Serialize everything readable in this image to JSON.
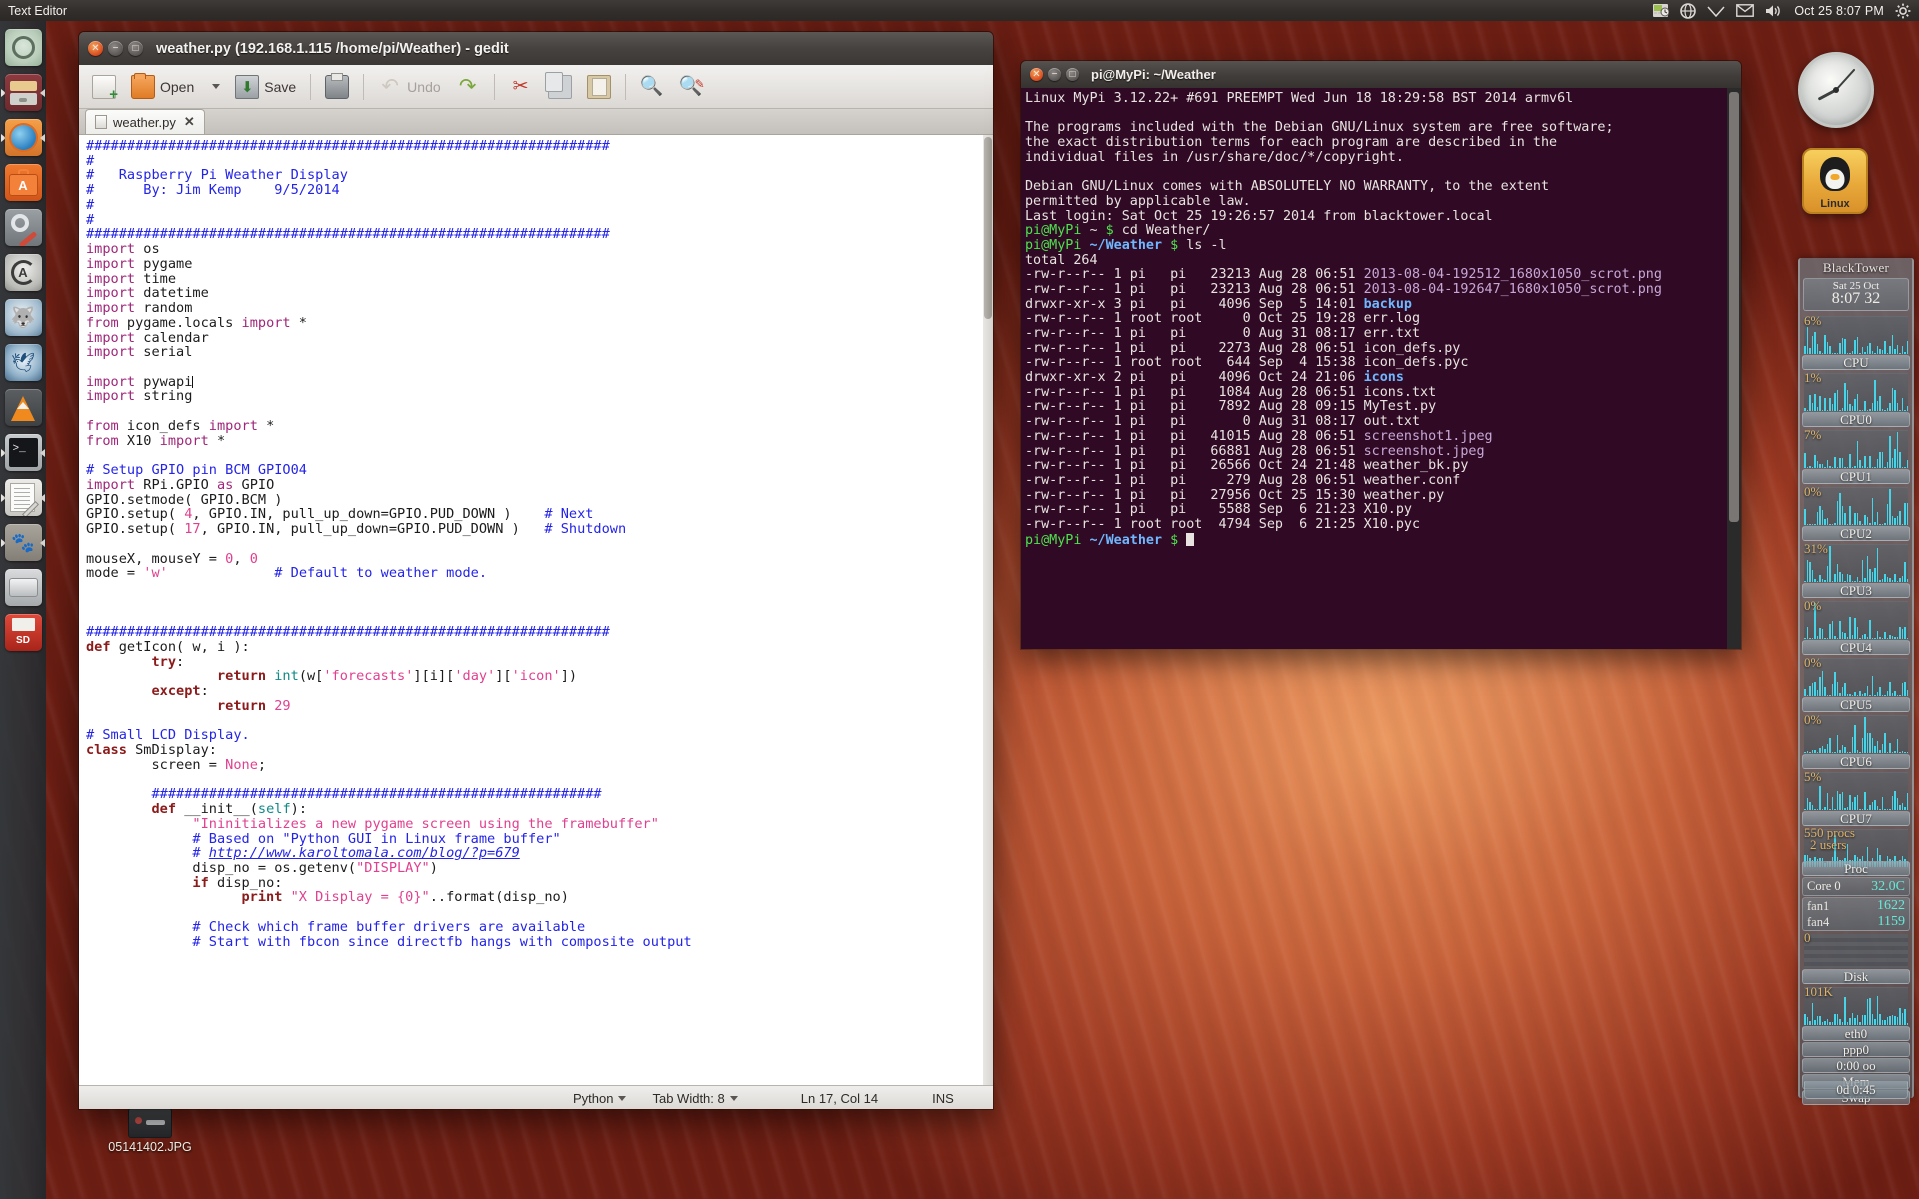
{
  "top_panel": {
    "title": "Text Editor",
    "indicators": [
      "workspace-switcher-icon",
      "network-icon",
      "wifi-icon",
      "mail-icon",
      "volume-icon"
    ],
    "clock": "Oct 25  8:07 PM",
    "session_icon": "gear-icon"
  },
  "launcher": {
    "items": [
      {
        "name": "ubuntu-dash",
        "label": "Ubuntu Dash",
        "running": false
      },
      {
        "name": "files",
        "label": "Files",
        "running": true
      },
      {
        "name": "firefox",
        "label": "Firefox",
        "running": true
      },
      {
        "name": "software-center",
        "label": "Ubuntu Software Center",
        "running": false
      },
      {
        "name": "system-settings",
        "label": "System Settings",
        "running": false
      },
      {
        "name": "software-updater",
        "label": "Software Updater",
        "running": false
      },
      {
        "name": "wolf-app",
        "label": "Amarok",
        "running": false
      },
      {
        "name": "thunderbird",
        "label": "Thunderbird",
        "running": false
      },
      {
        "name": "vlc",
        "label": "VLC Media Player",
        "running": false
      },
      {
        "name": "terminal",
        "label": "Terminal",
        "running": true
      },
      {
        "name": "gedit",
        "label": "Text Editor",
        "running": true
      },
      {
        "name": "gimp",
        "label": "GIMP",
        "running": true
      },
      {
        "name": "disk",
        "label": "Disk",
        "running": false
      },
      {
        "name": "sd-card",
        "label": "SD Card",
        "running": false
      }
    ]
  },
  "desktop": {
    "icon_label": "05141402.JPG"
  },
  "gedit": {
    "title": "weather.py (192.168.1.115 /home/pi/Weather) - gedit",
    "window_buttons": {
      "close": "close-button",
      "minimize": "minimize-button",
      "maximize": "maximize-button"
    },
    "toolbar": {
      "new_label": "",
      "open_label": "Open",
      "save_label": "Save",
      "print_label": "",
      "undo_label": "Undo",
      "redo_label": "",
      "cut_label": "",
      "copy_label": "",
      "paste_label": "",
      "find_label": "",
      "replace_label": ""
    },
    "tab": {
      "label": "weather.py",
      "close": "✕"
    },
    "status": {
      "language": "Python",
      "tab_width": "Tab Width: 8",
      "position": "Ln 17, Col 14",
      "insert_mode": "INS"
    },
    "code_lines": [
      [
        [
          "cmt",
          "################################################################"
        ]
      ],
      [
        [
          "cmt",
          "#"
        ]
      ],
      [
        [
          "cmt",
          "#   Raspberry Pi Weather Display"
        ]
      ],
      [
        [
          "cmt",
          "#      By: Jim Kemp    9/5/2014"
        ]
      ],
      [
        [
          "cmt",
          "#"
        ]
      ],
      [
        [
          "cmt",
          "#"
        ]
      ],
      [
        [
          "cmt",
          "################################################################"
        ]
      ],
      [
        [
          "kw",
          "import"
        ],
        [
          "plain",
          " os"
        ]
      ],
      [
        [
          "kw",
          "import"
        ],
        [
          "plain",
          " pygame"
        ]
      ],
      [
        [
          "kw",
          "import"
        ],
        [
          "plain",
          " time"
        ]
      ],
      [
        [
          "kw",
          "import"
        ],
        [
          "plain",
          " datetime"
        ]
      ],
      [
        [
          "kw",
          "import"
        ],
        [
          "plain",
          " random"
        ]
      ],
      [
        [
          "kw",
          "from"
        ],
        [
          "plain",
          " pygame.locals "
        ],
        [
          "kw",
          "import"
        ],
        [
          "plain",
          " *"
        ]
      ],
      [
        [
          "kw",
          "import"
        ],
        [
          "plain",
          " calendar"
        ]
      ],
      [
        [
          "kw",
          "import"
        ],
        [
          "plain",
          " serial"
        ]
      ],
      [
        [
          "plain",
          ""
        ]
      ],
      [
        [
          "kw",
          "import"
        ],
        [
          "plain",
          " pywapi"
        ],
        [
          "cursor",
          ""
        ]
      ],
      [
        [
          "kw",
          "import"
        ],
        [
          "plain",
          " string"
        ]
      ],
      [
        [
          "plain",
          ""
        ]
      ],
      [
        [
          "kw",
          "from"
        ],
        [
          "plain",
          " icon_defs "
        ],
        [
          "kw",
          "import"
        ],
        [
          "plain",
          " *"
        ]
      ],
      [
        [
          "kw",
          "from"
        ],
        [
          "plain",
          " X10 "
        ],
        [
          "kw",
          "import"
        ],
        [
          "plain",
          " *"
        ]
      ],
      [
        [
          "plain",
          ""
        ]
      ],
      [
        [
          "cmt",
          "# Setup GPIO pin BCM GPIO04"
        ]
      ],
      [
        [
          "kw",
          "import"
        ],
        [
          "plain",
          " RPi.GPIO "
        ],
        [
          "kw",
          "as"
        ],
        [
          "plain",
          " GPIO"
        ]
      ],
      [
        [
          "plain",
          "GPIO.setmode( GPIO.BCM )"
        ]
      ],
      [
        [
          "plain",
          "GPIO.setup( "
        ],
        [
          "num",
          "4"
        ],
        [
          "plain",
          ", GPIO.IN, pull_up_down=GPIO.PUD_DOWN )    "
        ],
        [
          "cmt",
          "# Next"
        ]
      ],
      [
        [
          "plain",
          "GPIO.setup( "
        ],
        [
          "num",
          "17"
        ],
        [
          "plain",
          ", GPIO.IN, pull_up_down=GPIO.PUD_DOWN )   "
        ],
        [
          "cmt",
          "# Shutdown"
        ]
      ],
      [
        [
          "plain",
          ""
        ]
      ],
      [
        [
          "plain",
          "mouseX, mouseY = "
        ],
        [
          "num",
          "0"
        ],
        [
          "plain",
          ", "
        ],
        [
          "num",
          "0"
        ]
      ],
      [
        [
          "plain",
          "mode = "
        ],
        [
          "str",
          "'w'"
        ],
        [
          "plain",
          "             "
        ],
        [
          "cmt",
          "# Default to weather mode."
        ]
      ],
      [
        [
          "plain",
          ""
        ]
      ],
      [
        [
          "plain",
          ""
        ]
      ],
      [
        [
          "plain",
          ""
        ]
      ],
      [
        [
          "cmt",
          "################################################################"
        ]
      ],
      [
        [
          "kw2",
          "def"
        ],
        [
          "plain",
          " getIcon( w, i ):"
        ]
      ],
      [
        [
          "plain",
          "        "
        ],
        [
          "kw2",
          "try"
        ],
        [
          "plain",
          ":"
        ]
      ],
      [
        [
          "plain",
          "                "
        ],
        [
          "kw2",
          "return"
        ],
        [
          "plain",
          " "
        ],
        [
          "bi",
          "int"
        ],
        [
          "plain",
          "(w["
        ],
        [
          "str",
          "'forecasts'"
        ],
        [
          "plain",
          "][i]["
        ],
        [
          "str",
          "'day'"
        ],
        [
          "plain",
          "]["
        ],
        [
          "str",
          "'icon'"
        ],
        [
          "plain",
          "])"
        ]
      ],
      [
        [
          "plain",
          "        "
        ],
        [
          "kw2",
          "except"
        ],
        [
          "plain",
          ":"
        ]
      ],
      [
        [
          "plain",
          "                "
        ],
        [
          "kw2",
          "return"
        ],
        [
          "plain",
          " "
        ],
        [
          "num",
          "29"
        ]
      ],
      [
        [
          "plain",
          ""
        ]
      ],
      [
        [
          "cmt",
          "# Small LCD Display."
        ]
      ],
      [
        [
          "kw2",
          "class"
        ],
        [
          "plain",
          " SmDisplay:"
        ]
      ],
      [
        [
          "plain",
          "        screen = "
        ],
        [
          "num",
          "None"
        ],
        [
          "plain",
          ";"
        ]
      ],
      [
        [
          "plain",
          ""
        ]
      ],
      [
        [
          "plain",
          "        "
        ],
        [
          "cmt",
          "#######################################################"
        ]
      ],
      [
        [
          "plain",
          "        "
        ],
        [
          "kw2",
          "def"
        ],
        [
          "plain",
          " __init__("
        ],
        [
          "cls",
          "self"
        ],
        [
          "plain",
          "):"
        ]
      ],
      [
        [
          "plain",
          "             "
        ],
        [
          "str",
          "\"Ininitializes a new pygame screen using the framebuffer\""
        ]
      ],
      [
        [
          "plain",
          "             "
        ],
        [
          "cmt",
          "# Based on \"Python GUI in Linux frame buffer\""
        ]
      ],
      [
        [
          "plain",
          "             "
        ],
        [
          "cmt",
          "# "
        ],
        [
          "cmt-u",
          "http://www.karoltomala.com/blog/?p=679"
        ]
      ],
      [
        [
          "plain",
          "             disp_no = os.getenv("
        ],
        [
          "str",
          "\"DISPLAY\""
        ],
        [
          "plain",
          ")"
        ]
      ],
      [
        [
          "plain",
          "             "
        ],
        [
          "kw2",
          "if"
        ],
        [
          "plain",
          " disp_no:"
        ]
      ],
      [
        [
          "plain",
          "                   "
        ],
        [
          "kw2",
          "print"
        ],
        [
          "plain",
          " "
        ],
        [
          "str",
          "\"X Display = {0}\""
        ],
        [
          "plain",
          "..format(disp_no)"
        ]
      ],
      [
        [
          "plain",
          ""
        ]
      ],
      [
        [
          "plain",
          "             "
        ],
        [
          "cmt",
          "# Check which frame buffer drivers are available"
        ]
      ],
      [
        [
          "plain",
          "             "
        ],
        [
          "cmt",
          "# Start with fbcon since directfb hangs with composite output"
        ]
      ]
    ]
  },
  "terminal": {
    "title": "pi@MyPi: ~/Weather",
    "lines": [
      [
        [
          "t-white",
          "Linux MyPi 3.12.22+ #691 PREEMPT Wed Jun 18 18:29:58 BST 2014 armv6l"
        ]
      ],
      [
        [
          "t-white",
          ""
        ]
      ],
      [
        [
          "t-white",
          "The programs included with the Debian GNU/Linux system are free software;"
        ]
      ],
      [
        [
          "t-white",
          "the exact distribution terms for each program are described in the"
        ]
      ],
      [
        [
          "t-white",
          "individual files in /usr/share/doc/*/copyright."
        ]
      ],
      [
        [
          "t-white",
          ""
        ]
      ],
      [
        [
          "t-white",
          "Debian GNU/Linux comes with ABSOLUTELY NO WARRANTY, to the extent"
        ]
      ],
      [
        [
          "t-white",
          "permitted by applicable law."
        ]
      ],
      [
        [
          "t-white",
          "Last login: Sat Oct 25 19:26:57 2014 from blacktower.local"
        ]
      ],
      [
        [
          "t-green",
          "pi@MyPi"
        ],
        [
          "t-white",
          " ~ "
        ],
        [
          "t-green",
          "$"
        ],
        [
          "t-white",
          " cd Weather/"
        ]
      ],
      [
        [
          "t-green",
          "pi@MyPi"
        ],
        [
          "t-white",
          " "
        ],
        [
          "t-blue",
          "~/Weather"
        ],
        [
          "t-white",
          " "
        ],
        [
          "t-green",
          "$"
        ],
        [
          "t-white",
          " ls -l"
        ]
      ],
      [
        [
          "t-white",
          "total 264"
        ]
      ],
      [
        [
          "t-white",
          "-rw-r--r-- 1 pi   pi   23213 Aug 28 06:51 "
        ],
        [
          "t-mag",
          "2013-08-04-192512_1680x1050_scrot.png"
        ]
      ],
      [
        [
          "t-white",
          "-rw-r--r-- 1 pi   pi   23213 Aug 28 06:51 "
        ],
        [
          "t-mag",
          "2013-08-04-192647_1680x1050_scrot.png"
        ]
      ],
      [
        [
          "t-white",
          "drwxr-xr-x 3 pi   pi    4096 Sep  5 14:01 "
        ],
        [
          "t-blue",
          "backup"
        ]
      ],
      [
        [
          "t-white",
          "-rw-r--r-- 1 root root     0 Oct 25 19:28 err.log"
        ]
      ],
      [
        [
          "t-white",
          "-rw-r--r-- 1 pi   pi       0 Aug 31 08:17 err.txt"
        ]
      ],
      [
        [
          "t-white",
          "-rw-r--r-- 1 pi   pi    2273 Aug 28 06:51 icon_defs.py"
        ]
      ],
      [
        [
          "t-white",
          "-rw-r--r-- 1 root root   644 Sep  4 15:38 icon_defs.pyc"
        ]
      ],
      [
        [
          "t-white",
          "drwxr-xr-x 2 pi   pi    4096 Oct 24 21:06 "
        ],
        [
          "t-blue",
          "icons"
        ]
      ],
      [
        [
          "t-white",
          "-rw-r--r-- 1 pi   pi    1084 Aug 28 06:51 icons.txt"
        ]
      ],
      [
        [
          "t-white",
          "-rw-r--r-- 1 pi   pi    7892 Aug 28 09:15 MyTest.py"
        ]
      ],
      [
        [
          "t-white",
          "-rw-r--r-- 1 pi   pi       0 Aug 31 08:17 out.txt"
        ]
      ],
      [
        [
          "t-white",
          "-rw-r--r-- 1 pi   pi   41015 Aug 28 06:51 "
        ],
        [
          "t-mag",
          "screenshot1.jpeg"
        ]
      ],
      [
        [
          "t-white",
          "-rw-r--r-- 1 pi   pi   66881 Aug 28 06:51 "
        ],
        [
          "t-mag",
          "screenshot.jpeg"
        ]
      ],
      [
        [
          "t-white",
          "-rw-r--r-- 1 pi   pi   26566 Oct 24 21:48 weather_bk.py"
        ]
      ],
      [
        [
          "t-white",
          "-rw-r--r-- 1 pi   pi     279 Aug 28 06:51 weather.conf"
        ]
      ],
      [
        [
          "t-white",
          "-rw-r--r-- 1 pi   pi   27956 Oct 25 15:30 weather.py"
        ]
      ],
      [
        [
          "t-white",
          "-rw-r--r-- 1 pi   pi    5588 Sep  6 21:23 X10.py"
        ]
      ],
      [
        [
          "t-white",
          "-rw-r--r-- 1 root root  4794 Sep  6 21:25 X10.pyc"
        ]
      ],
      [
        [
          "t-green",
          "pi@MyPi"
        ],
        [
          "t-white",
          " "
        ],
        [
          "t-blue",
          "~/Weather"
        ],
        [
          "t-white",
          " "
        ],
        [
          "t-green",
          "$"
        ],
        [
          "t-white",
          " "
        ],
        [
          "cursor",
          ""
        ]
      ]
    ]
  },
  "conky": {
    "header": "BlackTower",
    "date": "Sat 25 Oct",
    "time": "8:07 32",
    "cpu_blocks": [
      {
        "label": "CPU",
        "percent": "6%"
      },
      {
        "label": "CPU0",
        "percent": "1%"
      },
      {
        "label": "CPU1",
        "percent": "7%"
      },
      {
        "label": "CPU2",
        "percent": "0%"
      },
      {
        "label": "CPU3",
        "percent": "31%"
      },
      {
        "label": "CPU4",
        "percent": "0%"
      },
      {
        "label": "CPU5",
        "percent": "0%"
      },
      {
        "label": "CPU6",
        "percent": "0%"
      },
      {
        "label": "CPU7",
        "percent": "5%"
      }
    ],
    "proc": {
      "procs": "550 procs",
      "users": "2 users",
      "label": "Proc"
    },
    "temp": {
      "key": "Core 0",
      "value": "32.0C"
    },
    "fans": [
      {
        "key": "fan1",
        "value": "1622"
      },
      {
        "key": "fan4",
        "value": "1159"
      }
    ],
    "disk": {
      "value": "0",
      "label": "Disk"
    },
    "net": {
      "value": "101K",
      "eth": "eth0",
      "ppp": "ppp0",
      "uptime_small": "0:00  oo"
    },
    "mem_label": "Mem",
    "swap_label": "Swap",
    "uptime": "0d  0:45"
  },
  "widgets": {
    "clock_name": "analog-clock-widget",
    "tux_label": "Linux"
  },
  "colors": {
    "terminal_bg": "#300a24",
    "terminal_green": "#4ee24e",
    "terminal_blue": "#6fb8ff",
    "comment_blue": "#2424e8",
    "keyword_magenta": "#a0267a",
    "string_pink": "#e0408f",
    "conky_cyan": "#45d4e8",
    "conky_amber": "#e0b268"
  }
}
